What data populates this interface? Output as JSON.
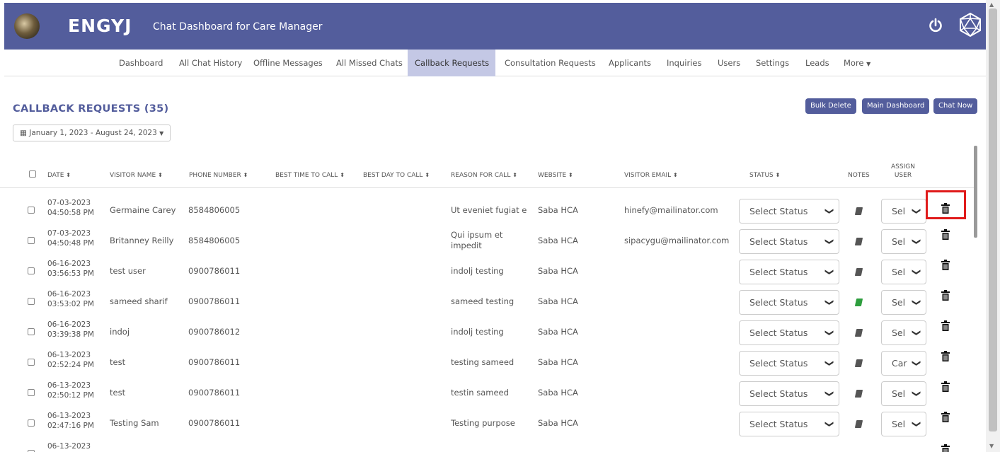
{
  "header": {
    "brand": "ENGYJ",
    "subtitle": "Chat Dashboard for Care Manager"
  },
  "nav": {
    "items": [
      "Dashboard",
      "All Chat History",
      "Offline Messages",
      "All Missed Chats",
      "Callback Requests",
      "Consultation Requests",
      "Applicants",
      "Inquiries",
      "Users",
      "Settings",
      "Leads",
      "More"
    ],
    "active": "Callback Requests"
  },
  "page": {
    "title": "CALLBACK REQUESTS (35)",
    "date_range": "January 1, 2023 - August 24, 2023"
  },
  "buttons": {
    "bulk_delete": "Bulk Delete",
    "main_dashboard": "Main Dashboard",
    "chat_now": "Chat Now"
  },
  "table": {
    "headers": {
      "date": "DATE",
      "visitor_name": "VISITOR NAME",
      "phone_number": "PHONE NUMBER",
      "best_time": "BEST TIME TO CALL",
      "best_day": "BEST DAY TO CALL",
      "reason": "REASON FOR CALL",
      "website": "WEBSITE",
      "visitor_email": "VISITOR EMAIL",
      "status": "STATUS",
      "notes": "NOTES",
      "assign_user_1": "ASSIGN",
      "assign_user_2": "USER"
    },
    "rows": [
      {
        "date": "07-03-2023",
        "time": "04:50:58 PM",
        "name": "Germaine Carey",
        "phone": "8584806005",
        "reason": "Ut eveniet fugiat e",
        "website": "Saba HCA",
        "email": "hinefy@mailinator.com",
        "status": "Select Status",
        "assign": "Sel",
        "note_color": "#555555"
      },
      {
        "date": "07-03-2023",
        "time": "04:50:48 PM",
        "name": "Britanney Reilly",
        "phone": "8584806005",
        "reason": "Qui ipsum et impedit",
        "website": "Saba HCA",
        "email": "sipacygu@mailinator.com",
        "status": "Select Status",
        "assign": "Sel",
        "note_color": "#555555"
      },
      {
        "date": "06-16-2023",
        "time": "03:56:53 PM",
        "name": "test user",
        "phone": "0900786011",
        "reason": "indolj testing",
        "website": "Saba HCA",
        "email": "",
        "status": "Select Status",
        "assign": "Sel",
        "note_color": "#555555"
      },
      {
        "date": "06-16-2023",
        "time": "03:53:02 PM",
        "name": "sameed sharif",
        "phone": "0900786011",
        "reason": "sameed testing",
        "website": "Saba HCA",
        "email": "",
        "status": "Select Status",
        "assign": "Sel",
        "note_color": "#2e9e3e"
      },
      {
        "date": "06-16-2023",
        "time": "03:39:38 PM",
        "name": "indoj",
        "phone": "0900786012",
        "reason": "indolj testing",
        "website": "Saba HCA",
        "email": "",
        "status": "Select Status",
        "assign": "Sel",
        "note_color": "#555555"
      },
      {
        "date": "06-13-2023",
        "time": "02:52:24 PM",
        "name": "test",
        "phone": "0900786011",
        "reason": "testing sameed",
        "website": "Saba HCA",
        "email": "",
        "status": "Select Status",
        "assign": "Car",
        "note_color": "#555555"
      },
      {
        "date": "06-13-2023",
        "time": "02:50:12 PM",
        "name": "test",
        "phone": "0900786011",
        "reason": "testin sameed",
        "website": "Saba HCA",
        "email": "",
        "status": "Select Status",
        "assign": "Sel",
        "note_color": "#555555"
      },
      {
        "date": "06-13-2023",
        "time": "02:47:16 PM",
        "name": "Testing Sam",
        "phone": "0900786011",
        "reason": "Testing purpose",
        "website": "Saba HCA",
        "email": "",
        "status": "Select Status",
        "assign": "Sel",
        "note_color": "#555555"
      },
      {
        "date": "06-13-2023",
        "time": "",
        "name": "",
        "phone": "",
        "reason": "",
        "website": "",
        "email": "",
        "status": "",
        "assign": "",
        "note_color": "#555555"
      }
    ]
  },
  "colors": {
    "header_bg": "#535d9c",
    "active_tab_bg": "#c4c8e5",
    "highlight": "#e01b1b"
  }
}
